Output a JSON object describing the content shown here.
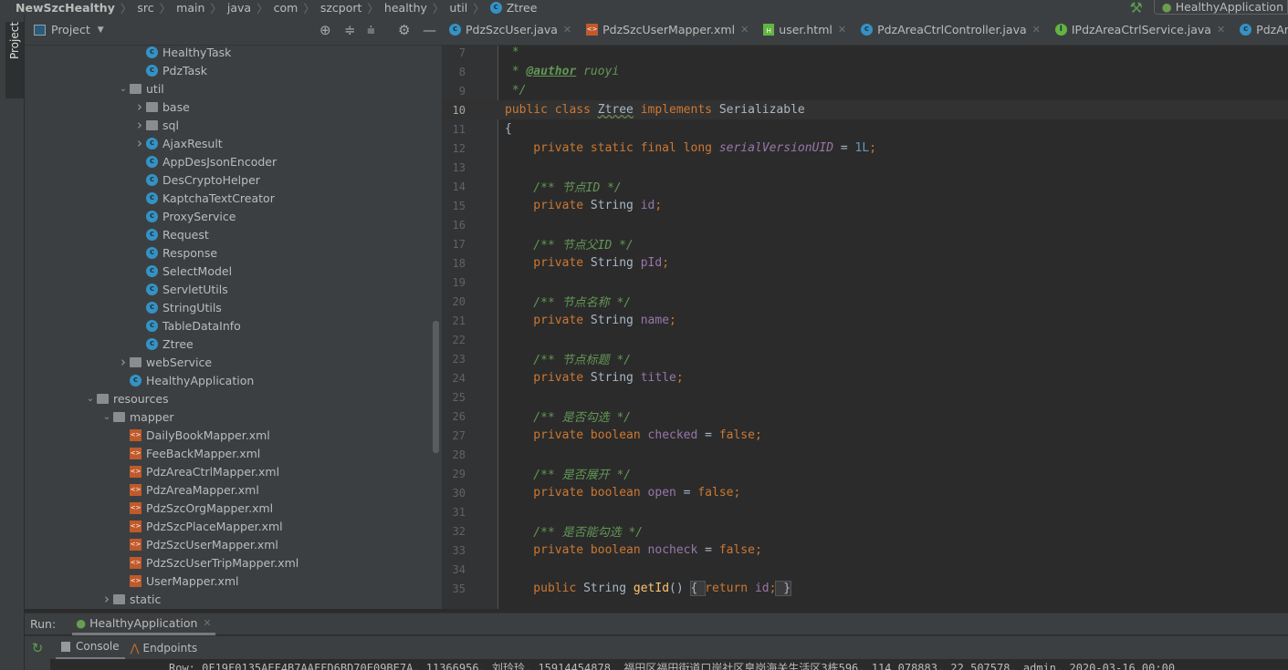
{
  "breadcrumb": [
    "NewSzcHealthy",
    "src",
    "main",
    "java",
    "com",
    "szcport",
    "healthy",
    "util",
    "Ztree"
  ],
  "run_config": "HealthyApplication",
  "side_strip": {
    "project_label": "Project"
  },
  "project_panel": {
    "title": "Project",
    "tree": [
      {
        "label": "HealthyTask",
        "level": 3,
        "icon": "class",
        "arrow": "none"
      },
      {
        "label": "PdzTask",
        "level": 3,
        "icon": "class",
        "arrow": "none"
      },
      {
        "label": "util",
        "level": 2,
        "icon": "folder",
        "arrow": "expanded"
      },
      {
        "label": "base",
        "level": 3,
        "icon": "folder",
        "arrow": "collapsed"
      },
      {
        "label": "sql",
        "level": 3,
        "icon": "folder",
        "arrow": "collapsed"
      },
      {
        "label": "AjaxResult",
        "level": 3,
        "icon": "class",
        "arrow": "collapsed"
      },
      {
        "label": "AppDesJsonEncoder",
        "level": 3,
        "icon": "class",
        "arrow": "none"
      },
      {
        "label": "DesCryptoHelper",
        "level": 3,
        "icon": "class",
        "arrow": "none"
      },
      {
        "label": "KaptchaTextCreator",
        "level": 3,
        "icon": "class",
        "arrow": "none"
      },
      {
        "label": "ProxyService",
        "level": 3,
        "icon": "class",
        "arrow": "none"
      },
      {
        "label": "Request",
        "level": 3,
        "icon": "class",
        "arrow": "none"
      },
      {
        "label": "Response",
        "level": 3,
        "icon": "class",
        "arrow": "none"
      },
      {
        "label": "SelectModel",
        "level": 3,
        "icon": "class",
        "arrow": "none"
      },
      {
        "label": "ServletUtils",
        "level": 3,
        "icon": "class",
        "arrow": "none"
      },
      {
        "label": "StringUtils",
        "level": 3,
        "icon": "class",
        "arrow": "none"
      },
      {
        "label": "TableDataInfo",
        "level": 3,
        "icon": "class",
        "arrow": "none"
      },
      {
        "label": "Ztree",
        "level": 3,
        "icon": "class",
        "arrow": "none"
      },
      {
        "label": "webService",
        "level": 2,
        "icon": "folder",
        "arrow": "collapsed"
      },
      {
        "label": "HealthyApplication",
        "level": 2,
        "icon": "spring-class",
        "arrow": "none"
      },
      {
        "label": "resources",
        "level": 0,
        "icon": "resources-folder",
        "arrow": "expanded"
      },
      {
        "label": "mapper",
        "level": 1,
        "icon": "folder",
        "arrow": "expanded"
      },
      {
        "label": "DailyBookMapper.xml",
        "level": 2,
        "icon": "xml",
        "arrow": "none"
      },
      {
        "label": "FeeBackMapper.xml",
        "level": 2,
        "icon": "xml",
        "arrow": "none"
      },
      {
        "label": "PdzAreaCtrlMapper.xml",
        "level": 2,
        "icon": "xml",
        "arrow": "none"
      },
      {
        "label": "PdzAreaMapper.xml",
        "level": 2,
        "icon": "xml",
        "arrow": "none"
      },
      {
        "label": "PdzSzcOrgMapper.xml",
        "level": 2,
        "icon": "xml",
        "arrow": "none"
      },
      {
        "label": "PdzSzcPlaceMapper.xml",
        "level": 2,
        "icon": "xml",
        "arrow": "none"
      },
      {
        "label": "PdzSzcUserMapper.xml",
        "level": 2,
        "icon": "xml",
        "arrow": "none"
      },
      {
        "label": "PdzSzcUserTripMapper.xml",
        "level": 2,
        "icon": "xml",
        "arrow": "none"
      },
      {
        "label": "UserMapper.xml",
        "level": 2,
        "icon": "xml",
        "arrow": "none"
      },
      {
        "label": "static",
        "level": 1,
        "icon": "folder",
        "arrow": "collapsed"
      }
    ]
  },
  "editor_tabs": [
    {
      "label": "PdzSzcUser.java",
      "icon": "class"
    },
    {
      "label": "PdzSzcUserMapper.xml",
      "icon": "xml"
    },
    {
      "label": "user.html",
      "icon": "html"
    },
    {
      "label": "PdzAreaCtrlController.java",
      "icon": "class"
    },
    {
      "label": "IPdzAreaCtrlService.java",
      "icon": "interface"
    },
    {
      "label": "PdzAreaCtrlS",
      "icon": "class"
    }
  ],
  "code": {
    "current_line": 10,
    "lines": [
      {
        "n": 7,
        "tokens": [
          [
            " *",
            "c"
          ]
        ]
      },
      {
        "n": 8,
        "tokens": [
          [
            " * ",
            "c"
          ],
          [
            "@author",
            "t"
          ],
          [
            " ruoyi",
            "c"
          ]
        ]
      },
      {
        "n": 9,
        "tokens": [
          [
            " */",
            "c"
          ]
        ]
      },
      {
        "n": 10,
        "tokens": [
          [
            "public class ",
            "k"
          ],
          [
            "Ztree",
            "u"
          ],
          [
            " implements ",
            "k"
          ],
          [
            "Serializable",
            "p"
          ]
        ]
      },
      {
        "n": 11,
        "tokens": [
          [
            "{",
            "p"
          ]
        ]
      },
      {
        "n": 12,
        "tokens": [
          [
            "    private static final long ",
            "k"
          ],
          [
            "serialVersionUID",
            "fi"
          ],
          [
            " = ",
            "p"
          ],
          [
            "1L",
            "n"
          ],
          [
            ";",
            "k"
          ]
        ]
      },
      {
        "n": 13,
        "tokens": []
      },
      {
        "n": 14,
        "tokens": [
          [
            "    /** 节点ID */",
            "c"
          ]
        ]
      },
      {
        "n": 15,
        "tokens": [
          [
            "    private ",
            "k"
          ],
          [
            "String ",
            "p"
          ],
          [
            "id",
            "f"
          ],
          [
            ";",
            "k"
          ]
        ]
      },
      {
        "n": 16,
        "tokens": []
      },
      {
        "n": 17,
        "tokens": [
          [
            "    /** 节点父ID */",
            "c"
          ]
        ]
      },
      {
        "n": 18,
        "tokens": [
          [
            "    private ",
            "k"
          ],
          [
            "String ",
            "p"
          ],
          [
            "pId",
            "f"
          ],
          [
            ";",
            "k"
          ]
        ]
      },
      {
        "n": 19,
        "tokens": []
      },
      {
        "n": 20,
        "tokens": [
          [
            "    /** 节点名称 */",
            "c"
          ]
        ]
      },
      {
        "n": 21,
        "tokens": [
          [
            "    private ",
            "k"
          ],
          [
            "String ",
            "p"
          ],
          [
            "name",
            "f"
          ],
          [
            ";",
            "k"
          ]
        ]
      },
      {
        "n": 22,
        "tokens": []
      },
      {
        "n": 23,
        "tokens": [
          [
            "    /** 节点标题 */",
            "c"
          ]
        ]
      },
      {
        "n": 24,
        "tokens": [
          [
            "    private ",
            "k"
          ],
          [
            "String ",
            "p"
          ],
          [
            "title",
            "f"
          ],
          [
            ";",
            "k"
          ]
        ]
      },
      {
        "n": 25,
        "tokens": []
      },
      {
        "n": 26,
        "tokens": [
          [
            "    /** 是否勾选 */",
            "c"
          ]
        ]
      },
      {
        "n": 27,
        "tokens": [
          [
            "    private boolean ",
            "k"
          ],
          [
            "checked",
            "f"
          ],
          [
            " = ",
            "p"
          ],
          [
            "false",
            "k"
          ],
          [
            ";",
            "k"
          ]
        ]
      },
      {
        "n": 28,
        "tokens": []
      },
      {
        "n": 29,
        "tokens": [
          [
            "    /** 是否展开 */",
            "c"
          ]
        ]
      },
      {
        "n": 30,
        "tokens": [
          [
            "    private boolean ",
            "k"
          ],
          [
            "open",
            "f"
          ],
          [
            " = ",
            "p"
          ],
          [
            "false",
            "k"
          ],
          [
            ";",
            "k"
          ]
        ]
      },
      {
        "n": 31,
        "tokens": []
      },
      {
        "n": 32,
        "tokens": [
          [
            "    /** 是否能勾选 */",
            "c"
          ]
        ]
      },
      {
        "n": 33,
        "tokens": [
          [
            "    private boolean ",
            "k"
          ],
          [
            "nocheck",
            "f"
          ],
          [
            " = ",
            "p"
          ],
          [
            "false",
            "k"
          ],
          [
            ";",
            "k"
          ]
        ]
      },
      {
        "n": 34,
        "tokens": []
      },
      {
        "n": 35,
        "tokens": [
          [
            "    public ",
            "k"
          ],
          [
            "String ",
            "p"
          ],
          [
            "getId",
            "fn"
          ],
          [
            "() ",
            "p"
          ],
          [
            "{ ",
            "fold"
          ],
          [
            "return ",
            "k"
          ],
          [
            "id",
            "f"
          ],
          [
            ";",
            "k"
          ],
          [
            " }",
            "fold"
          ]
        ]
      }
    ]
  },
  "run": {
    "label": "Run:",
    "tab": "HealthyApplication"
  },
  "console_tabs": [
    "Console",
    "Endpoints"
  ],
  "console_line": "Row: 0F19F0135AEF4B7AAFFD6BD70E09BE7A, 11366956, 刘玲玲, 15914454878, 福田区福田街道口岸社区皇岗海关生活区3栋596, 114.078883, 22.507578, admin, 2020-03-16 00:00"
}
